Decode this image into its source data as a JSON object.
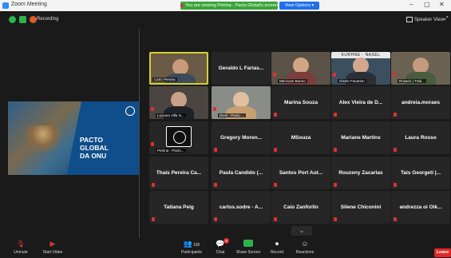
{
  "window": {
    "title": "Zoom Meeting",
    "share_banner": "You are viewing Petrina - Pacto Global's screen",
    "view_options": "View Options",
    "minimize": "–",
    "maximize": "▢",
    "close": "✕"
  },
  "status": {
    "recording_label": "Recording",
    "speaker_view": "Speaker View"
  },
  "shared_screen": {
    "text_line1": "PACTO",
    "text_line2": "GLOBAL",
    "text_line3": "DA ONU"
  },
  "gallery": {
    "video_tiles": [
      {
        "label": "Carlo Pereira"
      },
      {
        "label": "Mericone Bueno"
      },
      {
        "label": "Gisele Favareto"
      },
      {
        "label": "Rosario | Trab..."
      },
      {
        "label": "Luciana Villa N..."
      },
      {
        "label": "Dieni - Pacto ..."
      },
      {
        "label": "Petrina - Pacto..."
      }
    ],
    "sign_text": "KURHNE - NASEL",
    "name_tiles": [
      "Geraldo L Farias...",
      "Marina Souza",
      "Alex Vieira de D...",
      "andreia.moraes",
      "Gregory Moren...",
      "MSouza",
      "Mariane Martins",
      "Laura Rosso",
      "Thais Pereira Ca...",
      "Paula Candido (...",
      "Santos Port Aut...",
      "Rouzeny Zacarias",
      "Tais Georgeti |...",
      "Tatiana Peig",
      "carlos.sodre - A...",
      "Caio Zanforlin",
      "Silene Chiconini",
      "andrezza oi Oik..."
    ],
    "more_chevron": "⌄"
  },
  "toolbar": {
    "unmute": "Unmute",
    "start_video": "Start Video",
    "participants": "Participants",
    "participants_count": "100",
    "chat": "Chat",
    "chat_badge": "6",
    "share_screen": "Share Screen",
    "record": "Record",
    "reactions": "Reactions",
    "leave": "Leave"
  },
  "colors": {
    "share_banner_bg": "#3aa53a",
    "view_options_bg": "#1f6feb",
    "leave_bg": "#e02828",
    "active_speaker_border": "#d4d232",
    "muted_mic": "#e03131",
    "tile_bg": "#262626"
  }
}
